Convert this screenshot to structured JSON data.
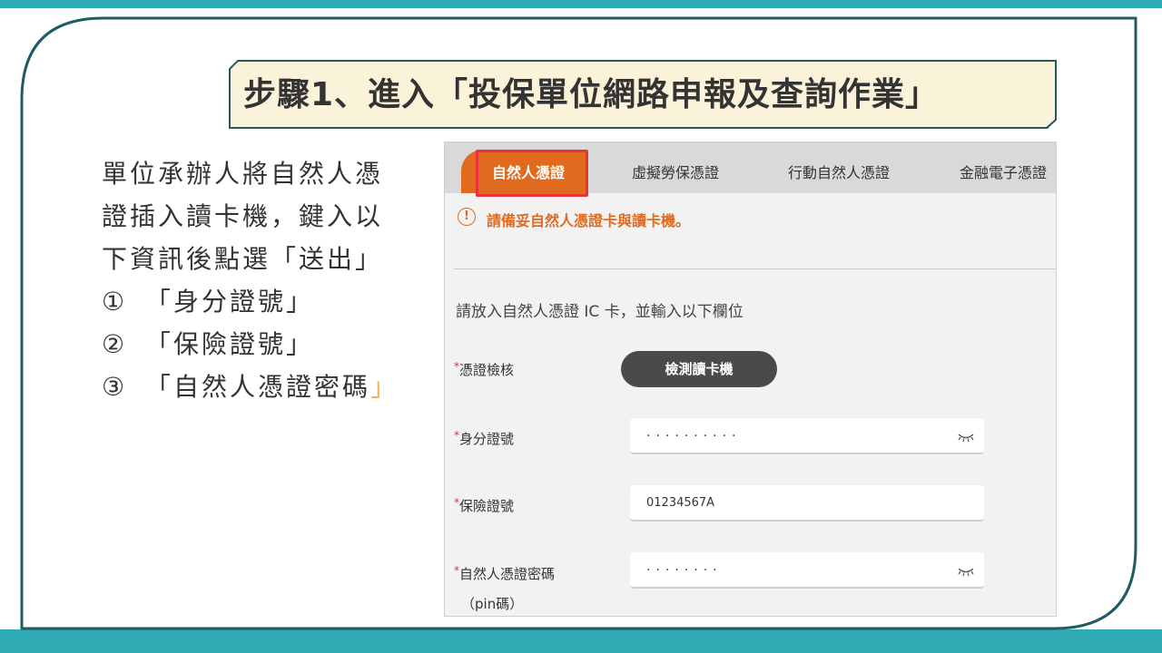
{
  "colors": {
    "teal": "#2fa9b3",
    "frame": "#1e5c62",
    "title_bg": "#fbf3d9",
    "tab_active": "#e06b1e",
    "highlight": "#e8323c",
    "required": "#d9303a"
  },
  "title": "步驟1、進入「投保單位網路申報及查詢作業」",
  "left": {
    "lines": [
      "單位承辦人將自然人憑",
      "證插入讀卡機，鍵入以",
      "下資訊後點選「送出」"
    ],
    "items": [
      {
        "mark": "①",
        "text": "「身分證號」",
        "tail": ""
      },
      {
        "mark": "②",
        "text": "「保險證號」",
        "tail": ""
      },
      {
        "mark": "③",
        "text": "「自然人憑證密碼",
        "tail": "」"
      }
    ]
  },
  "tabs": [
    {
      "label": "自然人憑證",
      "active": true
    },
    {
      "label": "虛擬勞保憑證",
      "active": false
    },
    {
      "label": "行動自然人憑證",
      "active": false
    },
    {
      "label": "金融電子憑證",
      "active": false
    }
  ],
  "warning": {
    "icon": "info-circle-icon",
    "symbol": "!",
    "text": "請備妥自然人憑證卡與讀卡機。"
  },
  "instruction": "請放入自然人憑證 IC 卡，並輸入以下欄位",
  "required_mark": "*",
  "fields": {
    "cert_check": {
      "label": "憑證檢核",
      "button": "檢測讀卡機"
    },
    "id_number": {
      "label": "身分證號",
      "value": "··········"
    },
    "insurance_number": {
      "label": "保險證號",
      "value": "01234567A"
    },
    "pin": {
      "label": "自然人憑證密碼",
      "sublabel": "（pin碼）",
      "value": "········"
    }
  }
}
